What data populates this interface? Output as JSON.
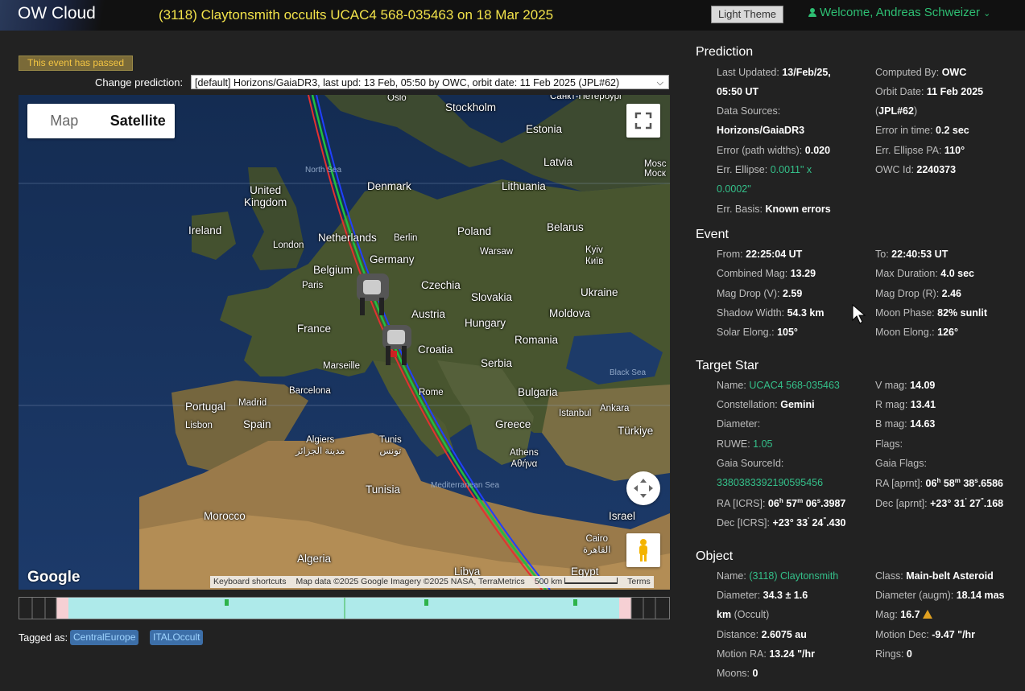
{
  "header": {
    "logo": "OW Cloud",
    "event_title": "(3118) Claytonsmith occults UCAC4 568-035463 on 18 Mar 2025",
    "theme_button": "Light Theme",
    "welcome": "Welcome, Andreas Schweizer"
  },
  "event_status": "This event has passed",
  "prediction_selector": {
    "label": "Change prediction:",
    "value": "[default] Horizons/GaiaDR3, last upd: 13 Feb, 05:50 by OWC, orbit date: 11 Feb 2025 (JPL#62)"
  },
  "map": {
    "type_map": "Map",
    "type_satellite": "Satellite",
    "google": "Google",
    "attribution": {
      "shortcuts": "Keyboard shortcuts",
      "data": "Map data ©2025 Google Imagery ©2025 NASA, TerraMetrics",
      "scale": "500 km",
      "terms": "Terms"
    },
    "labels": {
      "oslo": "Oslo",
      "stockholm": "Stockholm",
      "spb": "Санкт-Петербург",
      "estonia": "Estonia",
      "moscow": "Mosc\nМоск",
      "latvia": "Latvia",
      "northsea": "North Sea",
      "denmark": "Denmark",
      "lithuania": "Lithuania",
      "uk": "United\nKingdom",
      "ireland": "Ireland",
      "belarus": "Belarus",
      "london": "London",
      "netherlands": "Netherlands",
      "berlin": "Berlin",
      "poland": "Poland",
      "warsaw": "Warsaw",
      "belgium": "Belgium",
      "germany": "Germany",
      "kyiv": "Kyiv\nКиїв",
      "paris": "Paris",
      "czechia": "Czechia",
      "ukraine": "Ukraine",
      "slovakia": "Slovakia",
      "france": "France",
      "austria": "Austria",
      "moldova": "Moldova",
      "hungary": "Hungary",
      "romania": "Romania",
      "croatia": "Croatia",
      "marseille": "Marseille",
      "serbia": "Serbia",
      "blacksea": "Black Sea",
      "barcelona": "Barcelona",
      "rome": "Rome",
      "bulgaria": "Bulgaria",
      "portugal": "Portugal",
      "madrid": "Madrid",
      "istanbul": "Istanbul",
      "ankara": "Ankara",
      "spain": "Spain",
      "lisbon": "Lisbon",
      "greece": "Greece",
      "turkiye": "Türkiye",
      "algiers": "Algiers\nمدينة الجزائر",
      "tunis": "Tunis\nتونس",
      "athens": "Athens\nΑθήνα",
      "tunisia": "Tunisia",
      "medsea": "Mediterranean Sea",
      "morocco": "Morocco",
      "israel": "Israel",
      "cairo": "Cairo\nالقاهرة",
      "algeria": "Algeria",
      "libya": "Libya",
      "egypt": "Egypt"
    }
  },
  "tags": {
    "label": "Tagged as:",
    "items": [
      "CentralEurope",
      "ITALOccult"
    ]
  },
  "prediction": {
    "title": "Prediction",
    "last_updated_label": "Last Updated:",
    "last_updated_1": "13/Feb/25,",
    "last_updated_2": "05:50 UT",
    "computed_by_label": "Computed By:",
    "computed_by": "OWC",
    "orbit_date_label": "Orbit Date:",
    "orbit_date": "11 Feb 2025",
    "jpl_open": "(",
    "jpl": "JPL#62",
    "jpl_close": ")",
    "data_sources_label": "Data Sources:",
    "data_sources": "Horizons/GaiaDR3",
    "error_time_label": "Error in time:",
    "error_time": "0.2 sec",
    "error_path_label": "Error (path widths):",
    "error_path": "0.020",
    "err_pa_label": "Err. Ellipse PA:",
    "err_pa": "110°",
    "err_ellipse_label": "Err. Ellipse:",
    "err_ellipse_1": "0.0011\" x",
    "err_ellipse_2": "0.0002\"",
    "owc_id_label": "OWC Id:",
    "owc_id": "2240373",
    "err_basis_label": "Err. Basis:",
    "err_basis": "Known errors"
  },
  "event": {
    "title": "Event",
    "from_label": "From:",
    "from": "22:25:04 UT",
    "to_label": "To:",
    "to": "22:40:53 UT",
    "combined_mag_label": "Combined Mag:",
    "combined_mag": "13.29",
    "max_duration_label": "Max Duration:",
    "max_duration": "4.0 sec",
    "mag_drop_v_label": "Mag Drop (V):",
    "mag_drop_v": "2.59",
    "mag_drop_r_label": "Mag Drop (R):",
    "mag_drop_r": "2.46",
    "shadow_width_label": "Shadow Width:",
    "shadow_width": "54.3 km",
    "moon_phase_label": "Moon Phase:",
    "moon_phase": "82% sunlit",
    "solar_elong_label": "Solar Elong.:",
    "solar_elong": "105°",
    "moon_elong_label": "Moon Elong.:",
    "moon_elong": "126°"
  },
  "target_star": {
    "title": "Target Star",
    "name_label": "Name:",
    "name": "UCAC4 568-035463",
    "vmag_label": "V mag:",
    "vmag": "14.09",
    "constellation_label": "Constellation:",
    "constellation": "Gemini",
    "rmag_label": "R mag:",
    "rmag": "13.41",
    "diameter_label": "Diameter:",
    "bmag_label": "B mag:",
    "bmag": "14.63",
    "ruwe_label": "RUWE:",
    "ruwe": "1.05",
    "flags_label": "Flags:",
    "gaia_source_label": "Gaia SourceId:",
    "gaia_source": "3380383392190595456",
    "gaia_flags_label": "Gaia Flags:",
    "ra_aprnt_label": "RA [aprnt]:",
    "ra_icrs_label": "RA [ICRS]:",
    "dec_aprnt_label": "Dec [aprnt]:",
    "dec_icrs_label": "Dec [ICRS]:",
    "ra_aprnt": {
      "h": "06",
      "m": "58",
      "s": "38",
      "f": ".6586"
    },
    "ra_icrs": {
      "h": "06",
      "m": "57",
      "s": "06",
      "f": ".3987"
    },
    "dec_aprnt": {
      "d": "+23°",
      "m": "31",
      "s": "27",
      "f": ".168"
    },
    "dec_icrs": {
      "d": "+23°",
      "m": "33",
      "s": "24",
      "f": ".430"
    },
    "unit_h": "h",
    "unit_m": "m",
    "unit_s": "s",
    "unit_am": "'",
    "unit_as": "\""
  },
  "object": {
    "title": "Object",
    "name_label": "Name:",
    "name": "(3118) Claytonsmith",
    "class_label": "Class:",
    "class": "Main-belt Asteroid",
    "diameter_label": "Diameter:",
    "diameter_1": "34.3 ± 1.6",
    "diameter_2": "km",
    "diameter_note": "(Occult)",
    "diameter_augm_label": "Diameter (augm):",
    "diameter_augm": "18.14 mas",
    "mag_label": "Mag:",
    "mag": "16.7",
    "distance_label": "Distance:",
    "distance": "2.6075 au",
    "motion_dec_label": "Motion Dec:",
    "motion_dec": "-9.47 \"/hr",
    "motion_ra_label": "Motion RA:",
    "motion_ra": "13.24 \"/hr",
    "rings_label": "Rings:",
    "rings": "0",
    "moons_label": "Moons:",
    "moons": "0"
  },
  "colors": {
    "accent_green": "#34c08a",
    "title_yellow": "#f2e24a",
    "path_red": "#e53030",
    "path_green": "#20c040",
    "path_blue": "#2040ff"
  }
}
